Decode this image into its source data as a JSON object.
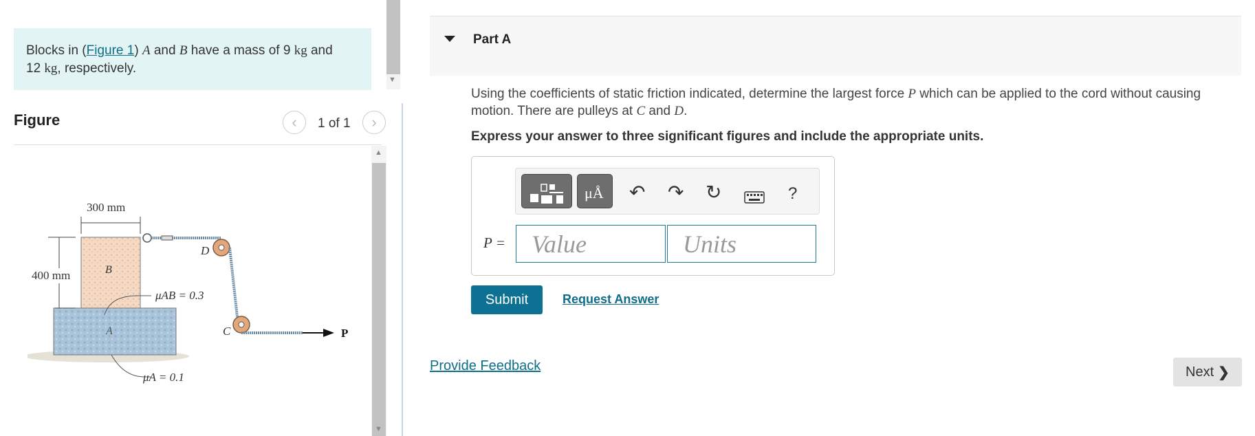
{
  "problem": {
    "text_before": "Blocks in (",
    "figure_link": "Figure 1",
    "text_mid1": ") ",
    "var_a": "A",
    "text_mid2": " and ",
    "var_b": "B",
    "text_mid3": " have a mass of 9 ",
    "unit1": "kg",
    "text_mid4": " and",
    "text_line2_num": "12 ",
    "unit2": "kg",
    "text_end": ", respectively."
  },
  "figure": {
    "title": "Figure",
    "counter": "1 of 1",
    "prev_icon": "chevron-left-icon",
    "next_icon": "chevron-right-icon",
    "labels": {
      "width_dim": "300 mm",
      "height_dim": "400 mm",
      "block_b": "B",
      "block_a": "A",
      "pulley_d": "D",
      "pulley_c": "C",
      "force": "P",
      "mu_ab": "μAB = 0.3",
      "mu_a": "μA = 0.1"
    }
  },
  "part": {
    "title": "Part A",
    "question_1": "Using the coefficients of static friction indicated, determine the largest force ",
    "q_var_p": "P",
    "question_2": " which can be applied to the cord without causing motion. There are pulleys at ",
    "q_var_c": "C",
    "question_3": " and ",
    "q_var_d": "D",
    "question_4": ".",
    "instruction": "Express your answer to three significant figures and include the appropriate units."
  },
  "answer": {
    "label": "P =",
    "value_placeholder": "Value",
    "units_placeholder": "Units",
    "toolbar": {
      "units_button": "μÅ",
      "help": "?"
    }
  },
  "actions": {
    "submit": "Submit",
    "request_answer": "Request Answer",
    "provide_feedback": "Provide Feedback",
    "next": "Next"
  }
}
